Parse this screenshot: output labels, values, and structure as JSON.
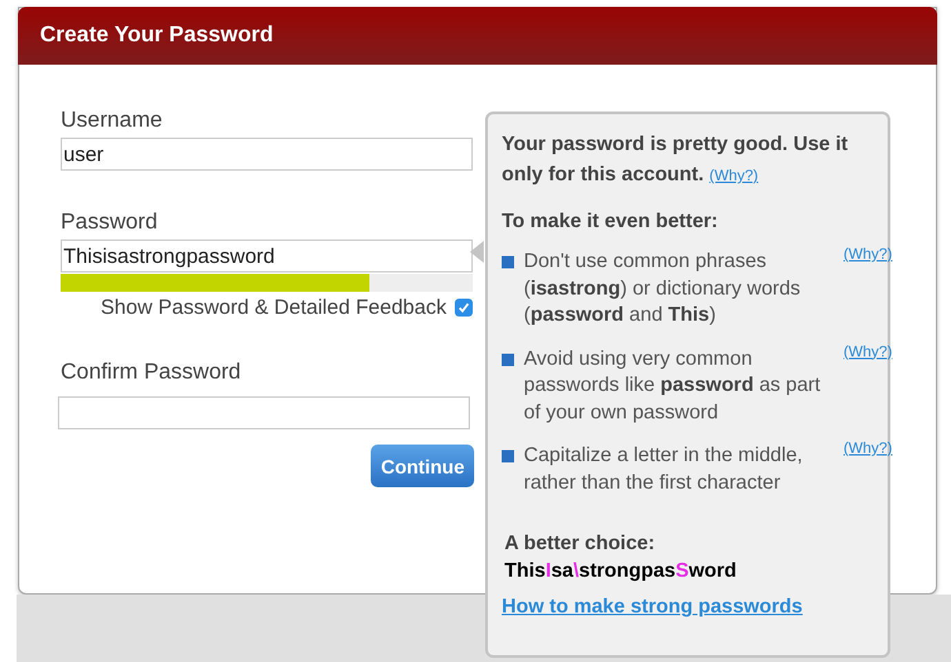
{
  "window": {
    "title": "Create Your Password"
  },
  "form": {
    "username": {
      "label": "Username",
      "value": "user"
    },
    "password": {
      "label": "Password",
      "value": "Thisisastrongpassword",
      "strength": {
        "level": 0.75
      }
    },
    "show_feedback": {
      "label": "Show Password & Detailed Feedback",
      "checked": true
    },
    "confirm": {
      "label": "Confirm Password"
    },
    "continue_button": "Continue"
  },
  "feedback": {
    "summary": "Your password is pretty good. Use it only for this account.",
    "summary_link": "(Why?)",
    "subheading": "To make it even better:",
    "tips": [
      {
        "text": "Don't use common phrases (**isastrong**) or dictionary words (**password** and **This**)",
        "link": "(Why?)"
      },
      {
        "text": "Avoid using very common passwords like **password** as part of your own password",
        "link": "(Why?)"
      },
      {
        "text": "Capitalize a letter in the middle, rather than the first character",
        "link": "(Why?)"
      }
    ],
    "better_choice": {
      "label": "A better choice:",
      "segments": [
        {
          "text": "This",
          "highlighted": false
        },
        {
          "text": "I",
          "highlighted": true
        },
        {
          "text": "sa",
          "highlighted": false
        },
        {
          "text": "\\",
          "highlighted": true
        },
        {
          "text": "strongpas",
          "highlighted": false
        },
        {
          "text": "S",
          "highlighted": true
        },
        {
          "text": "word",
          "highlighted": false
        }
      ]
    },
    "help_link": "How to make strong passwords"
  }
}
